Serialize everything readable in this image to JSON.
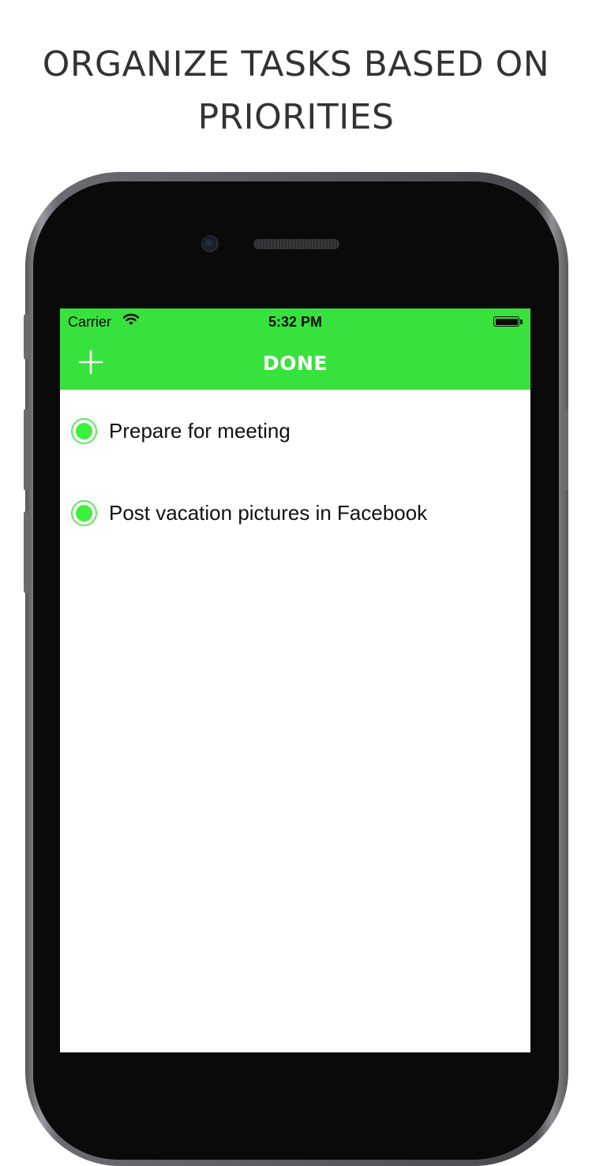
{
  "headline": {
    "line1": "ORGANIZE TASKS BASED ON",
    "line2": "PRIORITIES"
  },
  "colors": {
    "accent": "#38e23d",
    "task_dot": "#3af23a",
    "headline_text": "#333333"
  },
  "status_bar": {
    "carrier": "Carrier",
    "time": "5:32 PM",
    "wifi_icon": "wifi-icon",
    "battery_icon": "battery-full-icon"
  },
  "nav_bar": {
    "add_icon": "plus-icon",
    "title": "DONE"
  },
  "tasks": [
    {
      "label": "Prepare for meeting",
      "priority_icon": "green-dot-icon"
    },
    {
      "label": "Post vacation pictures in Facebook",
      "priority_icon": "green-dot-icon"
    }
  ]
}
